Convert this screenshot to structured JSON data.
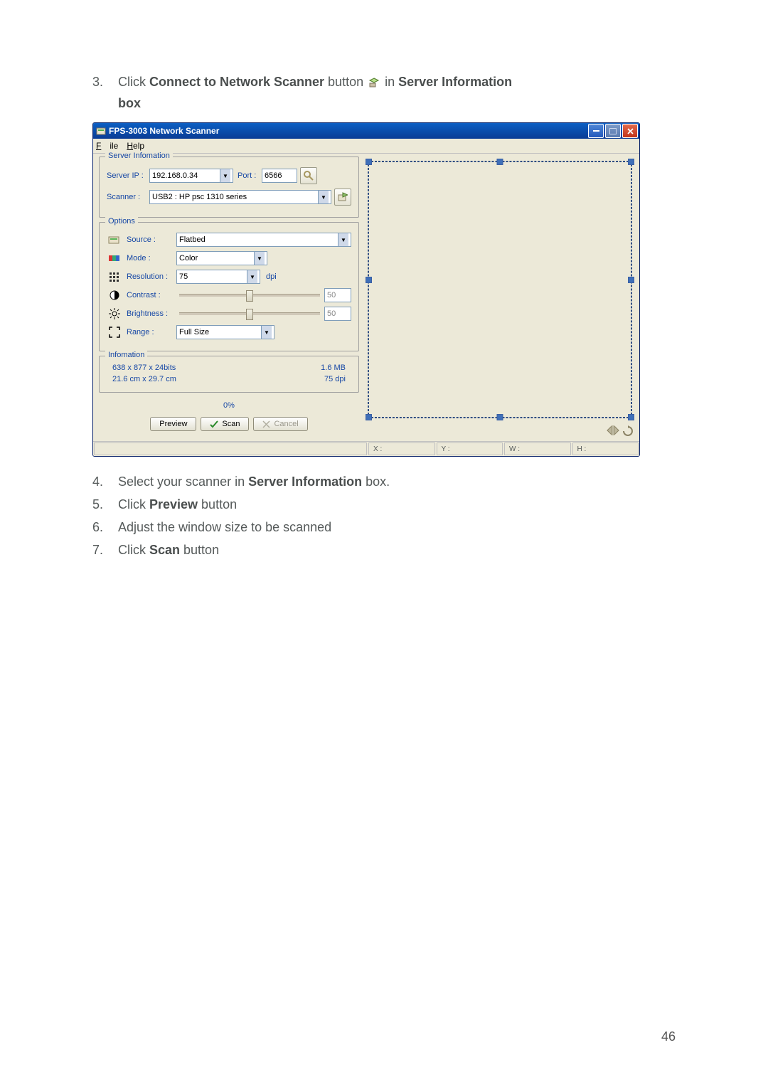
{
  "instructions": {
    "step3_num": "3.",
    "step3_a": "Click ",
    "step3_b": "Connect to Network Scanner",
    "step3_c": " button ",
    "step3_d": " in ",
    "step3_e": "Server Information",
    "step3_f": " box",
    "step4_num": "4.",
    "step4_a": "Select your scanner in ",
    "step4_b": "Server Information",
    "step4_c": " box.",
    "step5_num": "5.",
    "step5_a": "Click ",
    "step5_b": "Preview",
    "step5_c": " button",
    "step6_num": "6.",
    "step6_a": "Adjust the window size to be scanned",
    "step7_num": "7.",
    "step7_a": "Click ",
    "step7_b": "Scan",
    "step7_c": " button"
  },
  "window": {
    "title": "FPS-3003 Network Scanner",
    "menu_file": "File",
    "menu_help": "Help",
    "serverinfo_legend": "Server Infomation",
    "serverip_label": "Server IP :",
    "serverip_value": "192.168.0.34",
    "port_label": "Port :",
    "port_value": "6566",
    "scanner_label": "Scanner :",
    "scanner_value": "USB2 : HP psc 1310 series",
    "options_legend": "Options",
    "source_label": "Source :",
    "source_value": "Flatbed",
    "mode_label": "Mode :",
    "mode_value": "Color",
    "resolution_label": "Resolution :",
    "resolution_value": "75",
    "resolution_unit": "dpi",
    "contrast_label": "Contrast :",
    "contrast_value": "50",
    "brightness_label": "Brightness :",
    "brightness_value": "50",
    "range_label": "Range :",
    "range_value": "Full Size",
    "info_legend": "Infomation",
    "info_dims": "638 x 877 x 24bits",
    "info_size": "1.6 MB",
    "info_cm": "21.6 cm x 29.7 cm",
    "info_dpi": "75 dpi",
    "progress": "0%",
    "btn_preview": "Preview",
    "btn_scan": "Scan",
    "btn_cancel": "Cancel",
    "status_x": "X :",
    "status_y": "Y :",
    "status_w": "W :",
    "status_h": "H :"
  },
  "page_number": "46"
}
